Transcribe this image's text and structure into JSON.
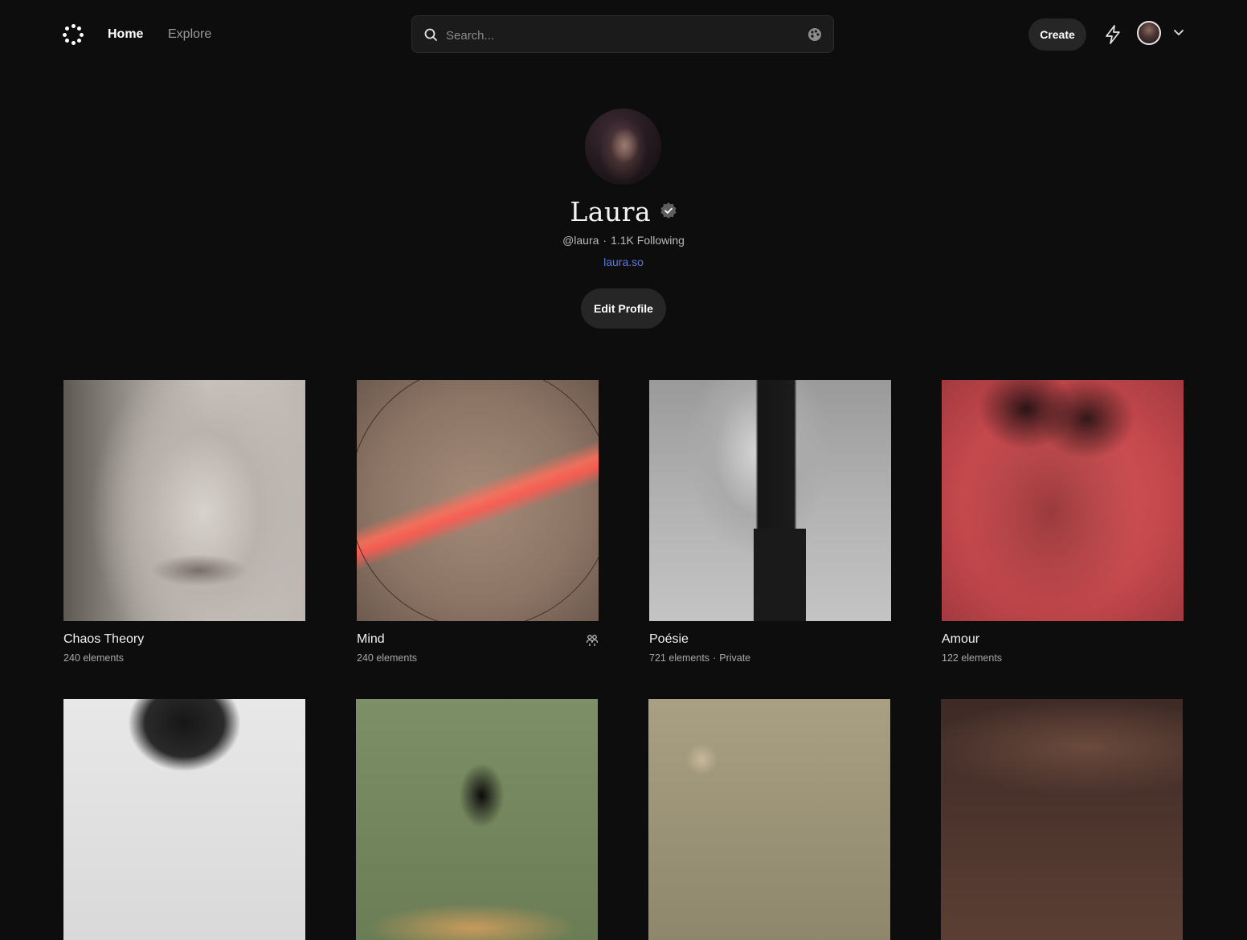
{
  "nav": {
    "home": "Home",
    "explore": "Explore"
  },
  "search": {
    "placeholder": "Search..."
  },
  "header": {
    "create_label": "Create"
  },
  "profile": {
    "name": "Laura",
    "handle": "@laura",
    "following": "1.1K Following",
    "website": "laura.so",
    "edit_label": "Edit Profile"
  },
  "collections": [
    {
      "title": "Chaos Theory",
      "count": "240 elements"
    },
    {
      "title": "Mind",
      "count": "240 elements"
    },
    {
      "title": "Poésie",
      "count": "721 elements",
      "visibility": "Private"
    },
    {
      "title": "Amour",
      "count": "122 elements"
    }
  ],
  "colors": {
    "background": "#0d0d0d",
    "link": "#5b7bd6",
    "button": "#262626"
  },
  "icons": [
    "logo-icon",
    "search-icon",
    "palette-icon",
    "lightning-icon",
    "chevron-down-icon",
    "verified-icon",
    "collaborators-icon"
  ]
}
